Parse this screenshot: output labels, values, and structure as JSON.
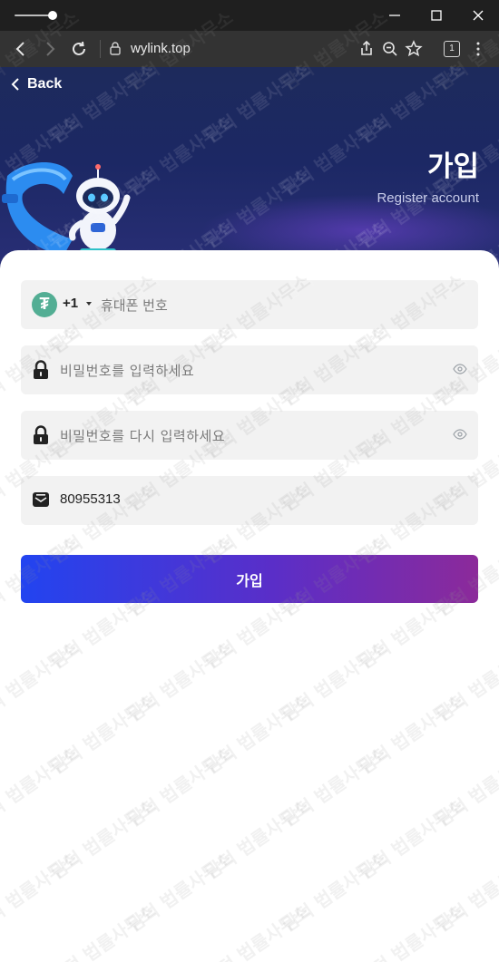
{
  "browser": {
    "url": "wylink.top",
    "tab_count": "1"
  },
  "hero": {
    "back_label": "Back",
    "title": "가입",
    "subtitle": "Register account"
  },
  "form": {
    "phone": {
      "country_code": "+1",
      "placeholder": "휴대폰 번호",
      "icon": "usdt-tether-icon"
    },
    "password": {
      "placeholder": "비밀번호를 입력하세요"
    },
    "confirm_password": {
      "placeholder": "비밀번호를 다시 입력하세요"
    },
    "invite_code": {
      "value": "80955313"
    },
    "submit_label": "가입"
  },
  "watermark": {
    "text": "담덕 법률사무소"
  },
  "colors": {
    "hero_bg": "#1d2a5c",
    "field_bg": "#f2f2f2",
    "usdt_green": "#53ae94",
    "button_start": "#2244f0",
    "button_end": "#8c2a9a"
  }
}
